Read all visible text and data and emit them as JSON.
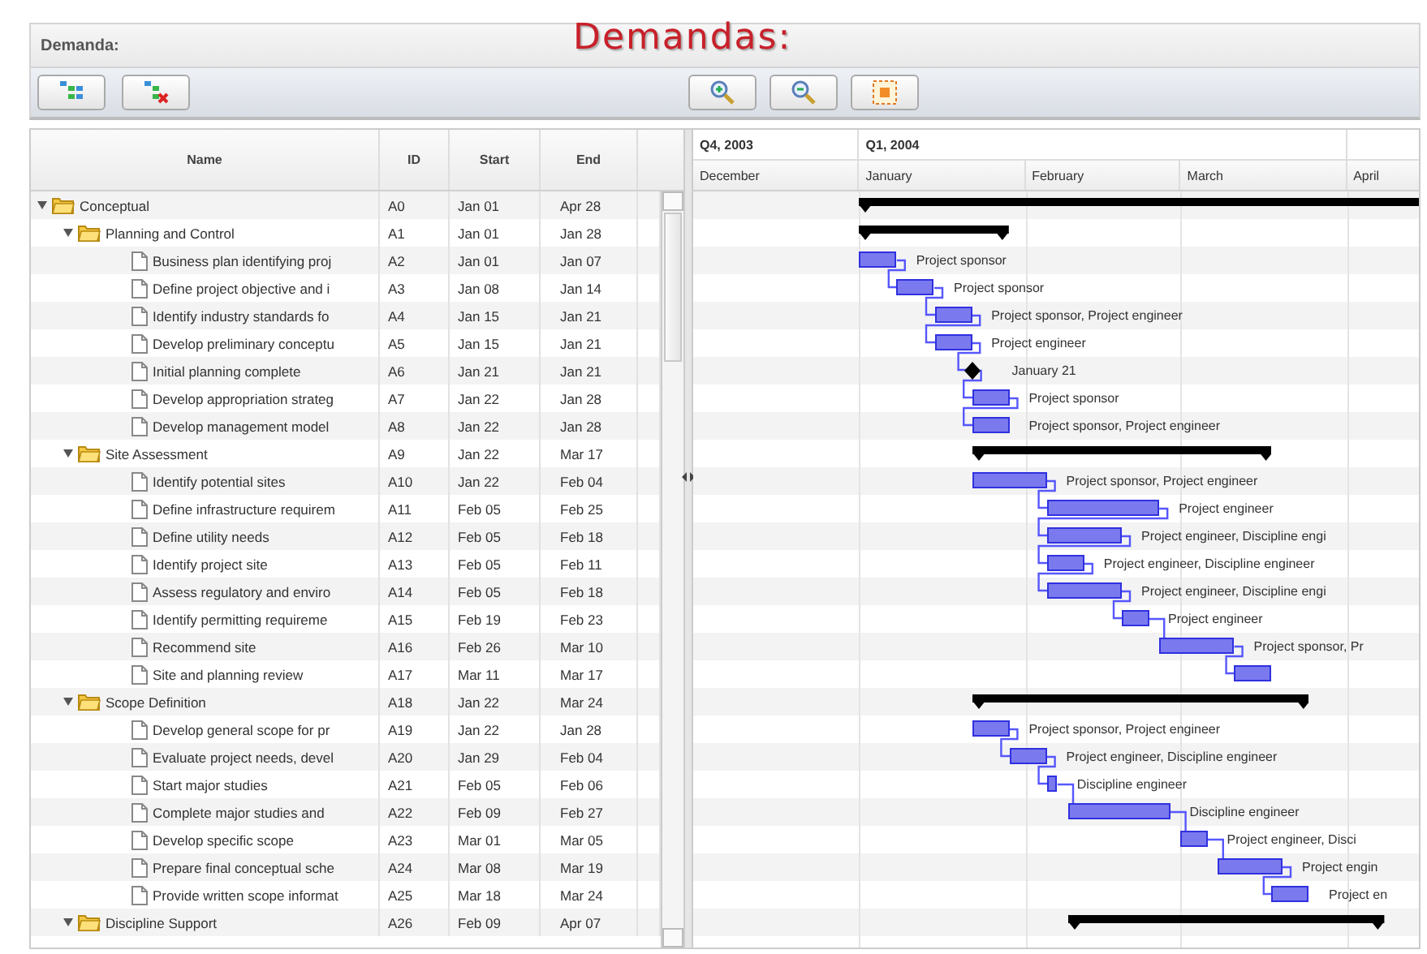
{
  "header": {
    "label": "Demanda:",
    "title": "Demandas:"
  },
  "toolbar": {
    "left": [
      {
        "kind": "expand"
      },
      {
        "kind": "collapse"
      }
    ],
    "center": [
      {
        "kind": "zoom-in"
      },
      {
        "kind": "zoom-out"
      },
      {
        "kind": "fit"
      }
    ]
  },
  "tree": {
    "columns": [
      "Name",
      "ID",
      "Start",
      "End"
    ]
  },
  "timeline": {
    "quarters": [
      "Q4, 2003",
      "Q1, 2004"
    ],
    "months": [
      "December",
      "January",
      "February",
      "March",
      "April"
    ]
  },
  "tasks": [
    {
      "name": "Conceptual",
      "id": "A0",
      "start": "Jan 01",
      "end": "Apr 28",
      "kind": "summary",
      "expanded": true,
      "children": [
        {
          "name": "Planning and Control",
          "id": "A1",
          "start": "Jan 01",
          "end": "Jan 28",
          "kind": "summary",
          "expanded": true,
          "children": [
            {
              "name": "Business plan identifying proj",
              "id": "A2",
              "start": "Jan 01",
              "end": "Jan 07",
              "kind": "task",
              "resources": "Project sponsor"
            },
            {
              "name": "Define project objective and i",
              "id": "A3",
              "start": "Jan 08",
              "end": "Jan 14",
              "kind": "task",
              "resources": "Project sponsor"
            },
            {
              "name": "Identify industry standards fo",
              "id": "A4",
              "start": "Jan 15",
              "end": "Jan 21",
              "kind": "task",
              "resources": "Project sponsor, Project engineer"
            },
            {
              "name": "Develop preliminary conceptu",
              "id": "A5",
              "start": "Jan 15",
              "end": "Jan 21",
              "kind": "task",
              "resources": "Project engineer"
            },
            {
              "name": "Initial planning complete",
              "id": "A6",
              "start": "Jan 21",
              "end": "Jan 21",
              "kind": "milestone",
              "resources": "January 21"
            },
            {
              "name": "Develop appropriation strateg",
              "id": "A7",
              "start": "Jan 22",
              "end": "Jan 28",
              "kind": "task",
              "resources": "Project sponsor"
            },
            {
              "name": "Develop management model",
              "id": "A8",
              "start": "Jan 22",
              "end": "Jan 28",
              "kind": "task",
              "resources": "Project sponsor, Project engineer"
            }
          ]
        },
        {
          "name": "Site Assessment",
          "id": "A9",
          "start": "Jan 22",
          "end": "Mar 17",
          "kind": "summary",
          "expanded": true,
          "children": [
            {
              "name": "Identify potential sites",
              "id": "A10",
              "start": "Jan 22",
              "end": "Feb 04",
              "kind": "task",
              "resources": "Project sponsor, Project engineer"
            },
            {
              "name": "Define infrastructure requirem",
              "id": "A11",
              "start": "Feb 05",
              "end": "Feb 25",
              "kind": "task",
              "resources": "Project engineer"
            },
            {
              "name": "Define utility needs",
              "id": "A12",
              "start": "Feb 05",
              "end": "Feb 18",
              "kind": "task",
              "resources": "Project engineer, Discipline engi"
            },
            {
              "name": "Identify project site",
              "id": "A13",
              "start": "Feb 05",
              "end": "Feb 11",
              "kind": "task",
              "resources": "Project engineer, Discipline engineer"
            },
            {
              "name": "Assess regulatory and enviro",
              "id": "A14",
              "start": "Feb 05",
              "end": "Feb 18",
              "kind": "task",
              "resources": "Project engineer, Discipline engi"
            },
            {
              "name": "Identify permitting requireme",
              "id": "A15",
              "start": "Feb 19",
              "end": "Feb 23",
              "kind": "task",
              "resources": "Project engineer"
            },
            {
              "name": "Recommend site",
              "id": "A16",
              "start": "Feb 26",
              "end": "Mar 10",
              "kind": "task",
              "resources": "Project sponsor, Pr"
            },
            {
              "name": "Site and planning review",
              "id": "A17",
              "start": "Mar 11",
              "end": "Mar 17",
              "kind": "task"
            }
          ]
        },
        {
          "name": "Scope Definition",
          "id": "A18",
          "start": "Jan 22",
          "end": "Mar 24",
          "kind": "summary",
          "expanded": true,
          "children": [
            {
              "name": "Develop general scope for pr",
              "id": "A19",
              "start": "Jan 22",
              "end": "Jan 28",
              "kind": "task",
              "resources": "Project sponsor, Project engineer"
            },
            {
              "name": "Evaluate project needs, devel",
              "id": "A20",
              "start": "Jan 29",
              "end": "Feb 04",
              "kind": "task",
              "resources": "Project engineer, Discipline engineer"
            },
            {
              "name": "Start major studies",
              "id": "A21",
              "start": "Feb 05",
              "end": "Feb 06",
              "kind": "task",
              "resources": "Discipline engineer"
            },
            {
              "name": "Complete major studies and",
              "id": "A22",
              "start": "Feb 09",
              "end": "Feb 27",
              "kind": "task",
              "resources": "Discipline engineer"
            },
            {
              "name": "Develop specific scope",
              "id": "A23",
              "start": "Mar 01",
              "end": "Mar 05",
              "kind": "task",
              "resources": "Project engineer, Disci"
            },
            {
              "name": "Prepare final conceptual sche",
              "id": "A24",
              "start": "Mar 08",
              "end": "Mar 19",
              "kind": "task",
              "resources": "Project engin"
            },
            {
              "name": "Provide written scope informat",
              "id": "A25",
              "start": "Mar 18",
              "end": "Mar 24",
              "kind": "task",
              "resources": "Project en"
            }
          ]
        },
        {
          "name": "Discipline Support",
          "id": "A26",
          "start": "Feb 09",
          "end": "Apr 07",
          "kind": "summary",
          "expanded": true
        }
      ]
    }
  ]
}
